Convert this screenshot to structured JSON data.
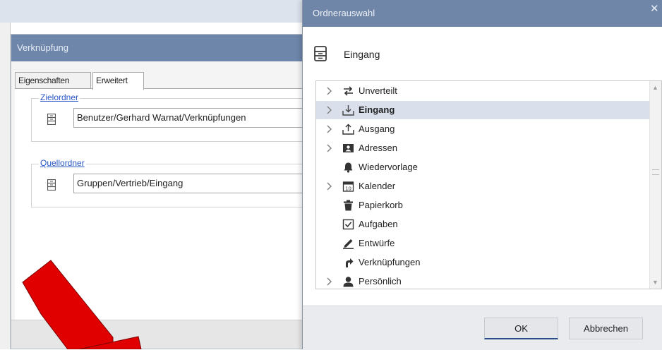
{
  "verknuepfung_dialog": {
    "title": "Verknüpfung",
    "tabs": [
      {
        "label": "Eigenschaften"
      },
      {
        "label": "Erweitert"
      }
    ],
    "zielordner": {
      "legend": "Zielordner",
      "value": "Benutzer/Gerhard Warnat/Verknüpfungen",
      "icon": "cabinet-icon"
    },
    "quellordner": {
      "legend": "Quellordner",
      "value": "Gruppen/Vertrieb/Eingang",
      "icon": "cabinet-icon"
    }
  },
  "ordnerauswahl_dialog": {
    "title": "Ordnerauswahl",
    "close_symbol": "✕",
    "header_label": "Eingang",
    "header_icon": "cabinet-icon",
    "tree": [
      {
        "label": "Unverteilt",
        "icon": "transfer-icon",
        "expandable": true,
        "selected": false
      },
      {
        "label": "Eingang",
        "icon": "inbox-icon",
        "expandable": true,
        "selected": true
      },
      {
        "label": "Ausgang",
        "icon": "outbox-icon",
        "expandable": true,
        "selected": false
      },
      {
        "label": "Adressen",
        "icon": "contact-card-icon",
        "expandable": true,
        "selected": false
      },
      {
        "label": "Wiedervorlage",
        "icon": "bell-icon",
        "expandable": false,
        "selected": false
      },
      {
        "label": "Kalender",
        "icon": "calendar-icon",
        "expandable": true,
        "selected": false
      },
      {
        "label": "Papierkorb",
        "icon": "trash-icon",
        "expandable": false,
        "selected": false
      },
      {
        "label": "Aufgaben",
        "icon": "checkbox-icon",
        "expandable": false,
        "selected": false
      },
      {
        "label": "Entwürfe",
        "icon": "pencil-icon",
        "expandable": false,
        "selected": false
      },
      {
        "label": "Verknüpfungen",
        "icon": "shortcut-arrow-icon",
        "expandable": false,
        "selected": false
      },
      {
        "label": "Persönlich",
        "icon": "person-icon",
        "expandable": true,
        "selected": false
      }
    ],
    "ok_label": "OK",
    "cancel_label": "Abbrechen"
  },
  "colors": {
    "title_bar": "#6f86a8",
    "selection": "#d9dfeb",
    "link": "#2a56c6",
    "arrow": "#e10000"
  }
}
